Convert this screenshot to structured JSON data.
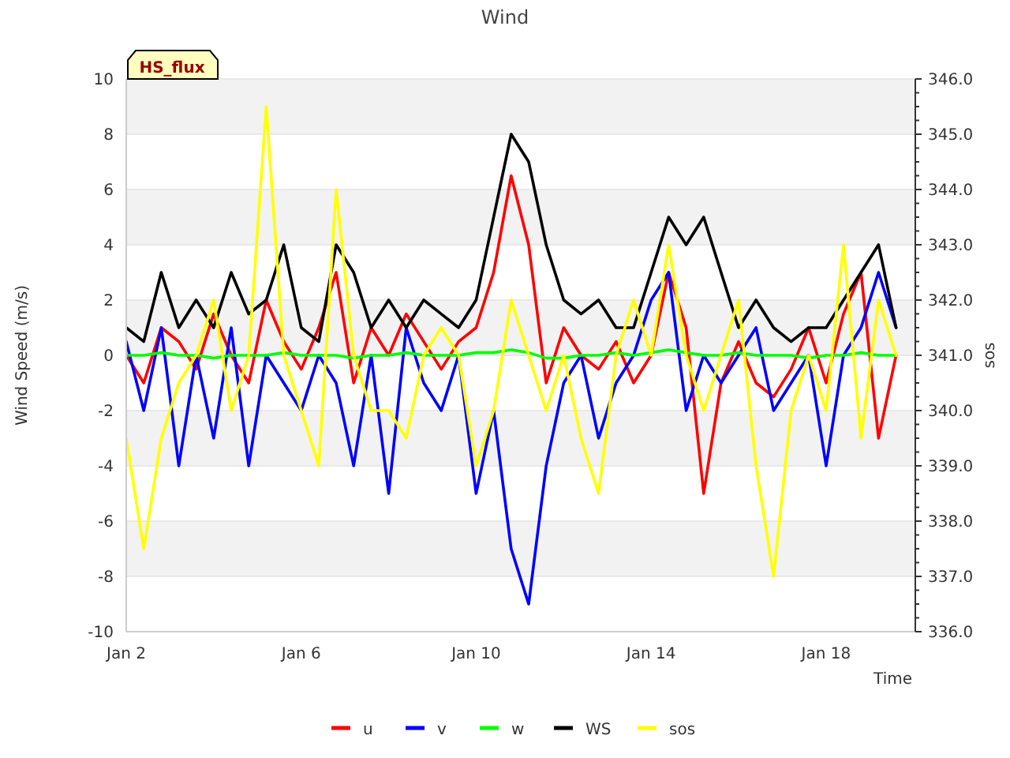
{
  "chart_data": {
    "type": "line",
    "title": "Wind",
    "xlabel": "Time",
    "ylabel": "Wind Speed (m/s)",
    "y2label": "sos",
    "categories": [
      "Jan 2",
      null,
      null,
      null,
      null,
      null,
      null,
      null,
      null,
      null,
      "Jan 6",
      null,
      null,
      null,
      null,
      null,
      null,
      null,
      null,
      null,
      "Jan 10",
      null,
      null,
      null,
      null,
      null,
      null,
      null,
      null,
      null,
      "Jan 14",
      null,
      null,
      null,
      null,
      null,
      null,
      null,
      null,
      null,
      "Jan 18",
      null,
      null,
      null,
      null
    ],
    "ylim": [
      -10,
      10
    ],
    "y2lim": [
      336,
      346
    ],
    "grid": true,
    "legend": "bottom",
    "yticks": [
      -10,
      -8,
      -6,
      -4,
      -2,
      0,
      2,
      4,
      6,
      8,
      10
    ],
    "y2ticks": [
      {
        "value": 336,
        "label": "336.0"
      },
      {
        "value": 337,
        "label": "337.0"
      },
      {
        "value": 338,
        "label": "338.0"
      },
      {
        "value": 339,
        "label": "339.0"
      },
      {
        "value": 340,
        "label": "340.0"
      },
      {
        "value": 341,
        "label": "341.0"
      },
      {
        "value": 342,
        "label": "342.0"
      },
      {
        "value": 343,
        "label": "343.0"
      },
      {
        "value": 344,
        "label": "344.0"
      },
      {
        "value": 345,
        "label": "345.0"
      },
      {
        "value": 346,
        "label": "346.0"
      }
    ],
    "series": [
      {
        "name": "u",
        "color": "#ff0000",
        "values": [
          0,
          -1,
          1,
          0.5,
          -0.5,
          1.5,
          0,
          -1,
          2,
          0.5,
          -0.5,
          1,
          3,
          -1,
          1,
          0,
          1.5,
          0.5,
          -0.5,
          0.5,
          1,
          3,
          6.5,
          4,
          -1,
          1,
          0,
          -0.5,
          0.5,
          -1,
          0,
          3,
          1,
          -5,
          -1,
          0.5,
          -1,
          -1.5,
          -0.5,
          1,
          -1,
          1.5,
          3,
          -3,
          0
        ]
      },
      {
        "name": "v",
        "color": "#0000ff",
        "values": [
          0.5,
          -2,
          1,
          -4,
          0,
          -3,
          1,
          -4,
          0,
          -1,
          -2,
          0,
          -1,
          -4,
          0,
          -5,
          1,
          -1,
          -2,
          0,
          -5,
          -2,
          -7,
          -9,
          -4,
          -1,
          0,
          -3,
          -1,
          0,
          2,
          3,
          -2,
          0,
          -1,
          0,
          1,
          -2,
          -1,
          0,
          -4,
          0,
          1,
          3,
          1
        ]
      },
      {
        "name": "w",
        "color": "#00ff00",
        "values": [
          0,
          0,
          0.1,
          0,
          0,
          -0.1,
          0,
          0,
          0,
          0.1,
          0,
          0,
          0,
          -0.1,
          0,
          0,
          0.1,
          0,
          0,
          0,
          0.1,
          0.1,
          0.2,
          0.1,
          -0.1,
          -0.1,
          0,
          0,
          0.1,
          0,
          0.1,
          0.2,
          0.1,
          0,
          0,
          0.1,
          0,
          0,
          0,
          -0.1,
          0,
          0,
          0.1,
          0,
          0
        ]
      },
      {
        "name": "WS",
        "color": "#000000",
        "values": [
          1,
          0.5,
          3,
          1,
          2,
          1,
          3,
          1.5,
          2,
          4,
          1,
          0.5,
          4,
          3,
          1,
          2,
          1,
          2,
          1.5,
          1,
          2,
          5,
          8,
          7,
          4,
          2,
          1.5,
          2,
          1,
          1,
          3,
          5,
          4,
          5,
          3,
          1,
          2,
          1,
          0.5,
          1,
          1,
          2,
          3,
          4,
          1
        ]
      },
      {
        "name": "sos",
        "color": "#ffff00",
        "axis": "y2",
        "values": [
          339.5,
          337.5,
          339.5,
          340.5,
          341,
          342,
          340,
          341,
          345.5,
          341,
          340,
          339,
          344,
          341,
          340,
          340,
          339.5,
          341,
          341.5,
          341,
          339,
          340,
          342,
          341,
          340,
          341,
          339.5,
          338.5,
          341,
          342,
          341,
          343,
          341,
          340,
          341,
          342,
          339,
          337,
          340,
          341,
          340,
          343,
          339.5,
          342,
          341
        ]
      }
    ],
    "annotations": [
      {
        "text": "HS_flux"
      }
    ]
  }
}
